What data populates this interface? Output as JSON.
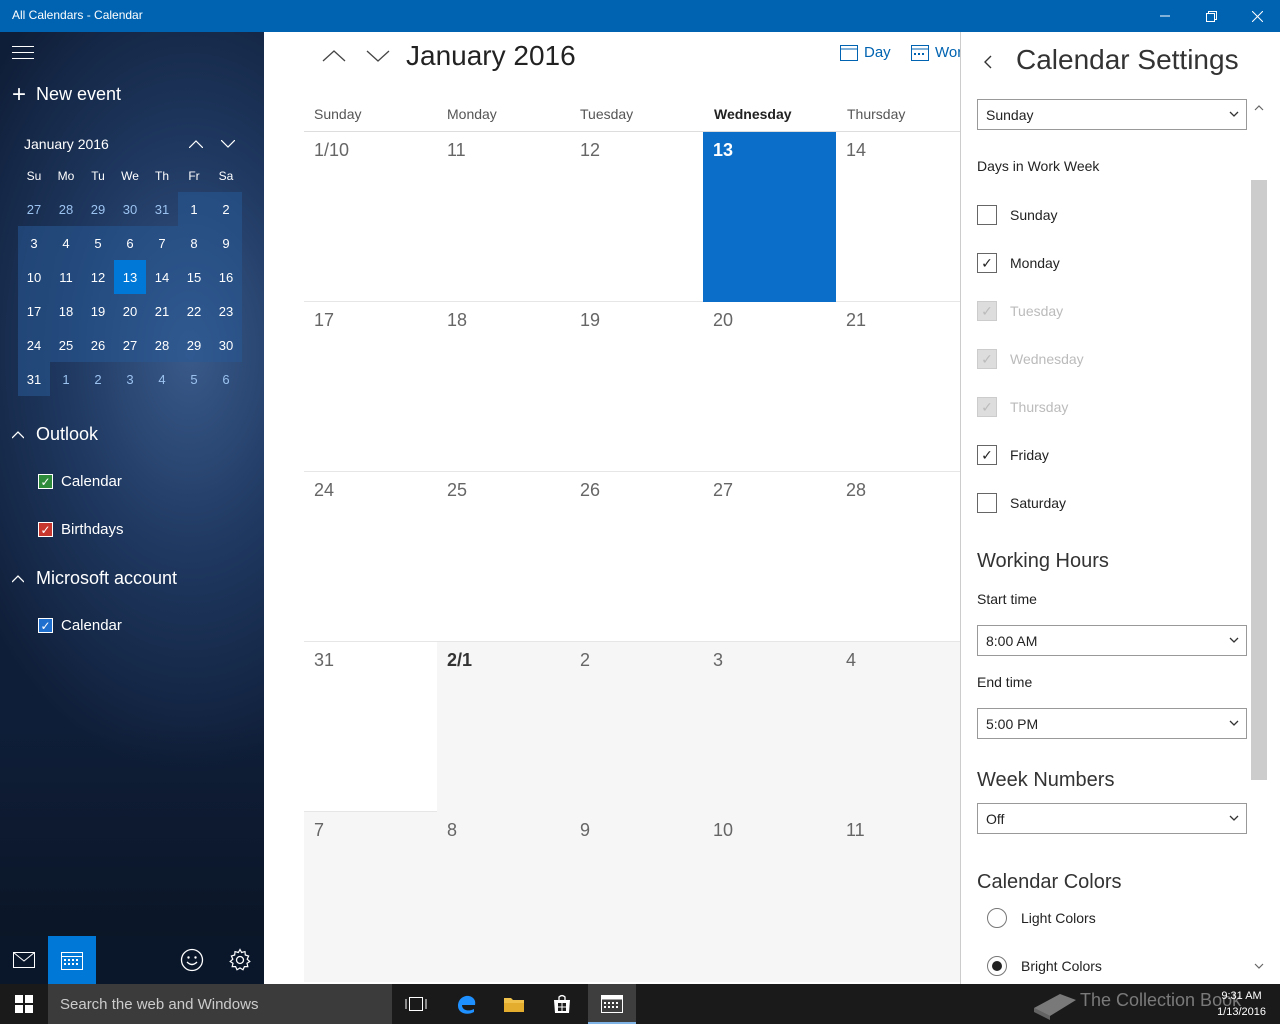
{
  "window": {
    "title": "All Calendars - Calendar"
  },
  "sidebar": {
    "new_event": "New event",
    "mini_calendar": {
      "title": "January 2016",
      "weekdays": [
        "Su",
        "Mo",
        "Tu",
        "We",
        "Th",
        "Fr",
        "Sa"
      ],
      "weeks": [
        [
          "27",
          "28",
          "29",
          "30",
          "31",
          "1",
          "2"
        ],
        [
          "3",
          "4",
          "5",
          "6",
          "7",
          "8",
          "9"
        ],
        [
          "10",
          "11",
          "12",
          "13",
          "14",
          "15",
          "16"
        ],
        [
          "17",
          "18",
          "19",
          "20",
          "21",
          "22",
          "23"
        ],
        [
          "24",
          "25",
          "26",
          "27",
          "28",
          "29",
          "30"
        ],
        [
          "31",
          "1",
          "2",
          "3",
          "4",
          "5",
          "6"
        ]
      ],
      "today": "13"
    },
    "groups": [
      {
        "name": "Outlook",
        "items": [
          {
            "label": "Calendar",
            "color": "#2e8b3a"
          },
          {
            "label": "Birthdays",
            "color": "#c8372d"
          }
        ]
      },
      {
        "name": "Microsoft account",
        "items": [
          {
            "label": "Calendar",
            "color": "#1f6fcf"
          }
        ]
      }
    ]
  },
  "main": {
    "month_title": "January 2016",
    "views": {
      "day": "Day",
      "work_week": "Wor"
    },
    "day_headers": [
      "Sunday",
      "Monday",
      "Tuesday",
      "Wednesday",
      "Thursday"
    ],
    "current_day_header": "Wednesday",
    "weeks": [
      [
        "1/10",
        "11",
        "12",
        "13",
        "14"
      ],
      [
        "17",
        "18",
        "19",
        "20",
        "21"
      ],
      [
        "24",
        "25",
        "26",
        "27",
        "28"
      ],
      [
        "31",
        "2/1",
        "2",
        "3",
        "4"
      ],
      [
        "7",
        "8",
        "9",
        "10",
        "11"
      ]
    ]
  },
  "settings": {
    "title": "Calendar Settings",
    "first_day_value": "Sunday",
    "days_in_work_week_label": "Days in Work Week",
    "work_days": [
      {
        "label": "Sunday",
        "checked": false,
        "disabled": false
      },
      {
        "label": "Monday",
        "checked": true,
        "disabled": false
      },
      {
        "label": "Tuesday",
        "checked": true,
        "disabled": true
      },
      {
        "label": "Wednesday",
        "checked": true,
        "disabled": true
      },
      {
        "label": "Thursday",
        "checked": true,
        "disabled": true
      },
      {
        "label": "Friday",
        "checked": true,
        "disabled": false
      },
      {
        "label": "Saturday",
        "checked": false,
        "disabled": false
      }
    ],
    "working_hours_heading": "Working Hours",
    "start_time_label": "Start time",
    "start_time_value": "8:00 AM",
    "end_time_label": "End time",
    "end_time_value": "5:00 PM",
    "week_numbers_heading": "Week Numbers",
    "week_numbers_value": "Off",
    "calendar_colors_heading": "Calendar Colors",
    "color_options": [
      {
        "label": "Light Colors",
        "selected": false
      },
      {
        "label": "Bright Colors",
        "selected": true
      }
    ]
  },
  "taskbar": {
    "search_placeholder": "Search the web and Windows",
    "time": "9:31 AM",
    "date": "1/13/2016",
    "watermark": "The Collection Book"
  },
  "colors": {
    "accent": "#0078d7",
    "titlebar": "#0063b1",
    "today": "#0b6fc9"
  }
}
